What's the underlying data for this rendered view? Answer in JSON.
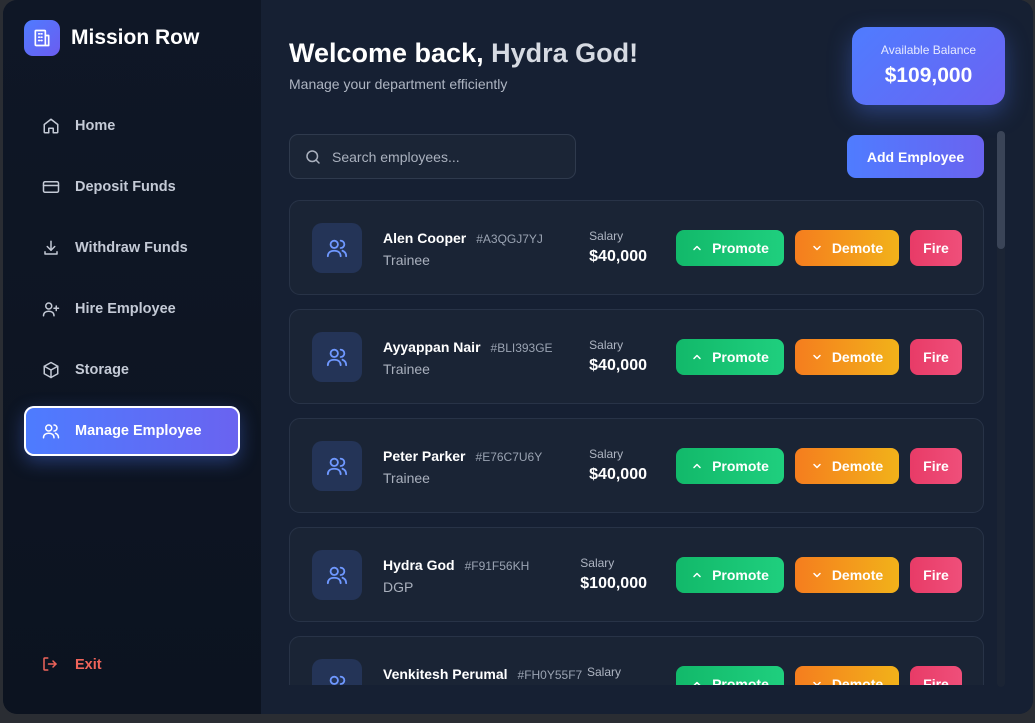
{
  "brand": {
    "title": "Mission Row",
    "icon": "building-icon"
  },
  "sidebar": {
    "items": [
      {
        "label": "Home",
        "icon": "home-icon",
        "active": false
      },
      {
        "label": "Deposit Funds",
        "icon": "card-icon",
        "active": false
      },
      {
        "label": "Withdraw Funds",
        "icon": "download-icon",
        "active": false
      },
      {
        "label": "Hire Employee",
        "icon": "user-plus-icon",
        "active": false
      },
      {
        "label": "Storage",
        "icon": "box-icon",
        "active": false
      },
      {
        "label": "Manage Employee",
        "icon": "users-icon",
        "active": true
      }
    ],
    "exit_label": "Exit"
  },
  "header": {
    "welcome_prefix": "Welcome back,",
    "user_name": "Hydra God!",
    "subtitle": "Manage your department efficiently"
  },
  "balance": {
    "label": "Available Balance",
    "value": "$109,000"
  },
  "search": {
    "placeholder": "Search employees..."
  },
  "toolbar": {
    "add_label": "Add Employee"
  },
  "actions": {
    "promote": "Promote",
    "demote": "Demote",
    "fire": "Fire"
  },
  "salary_label": "Salary",
  "employees": [
    {
      "name": "Alen Cooper",
      "id": "#A3QGJ7YJ",
      "role": "Trainee",
      "salary": "$40,000"
    },
    {
      "name": "Ayyappan Nair",
      "id": "#BLI393GE",
      "role": "Trainee",
      "salary": "$40,000"
    },
    {
      "name": "Peter Parker",
      "id": "#E76C7U6Y",
      "role": "Trainee",
      "salary": "$40,000"
    },
    {
      "name": "Hydra God",
      "id": "#F91F56KH",
      "role": "DGP",
      "salary": "$100,000"
    },
    {
      "name": "Venkitesh Perumal",
      "id": "#FH0Y55F7",
      "role": "",
      "salary": ""
    }
  ],
  "colors": {
    "accent": "#4f7cff",
    "promote": "#12b96a",
    "demote": "#f57d1e",
    "fire": "#e83b67",
    "exit": "#f0645a"
  }
}
